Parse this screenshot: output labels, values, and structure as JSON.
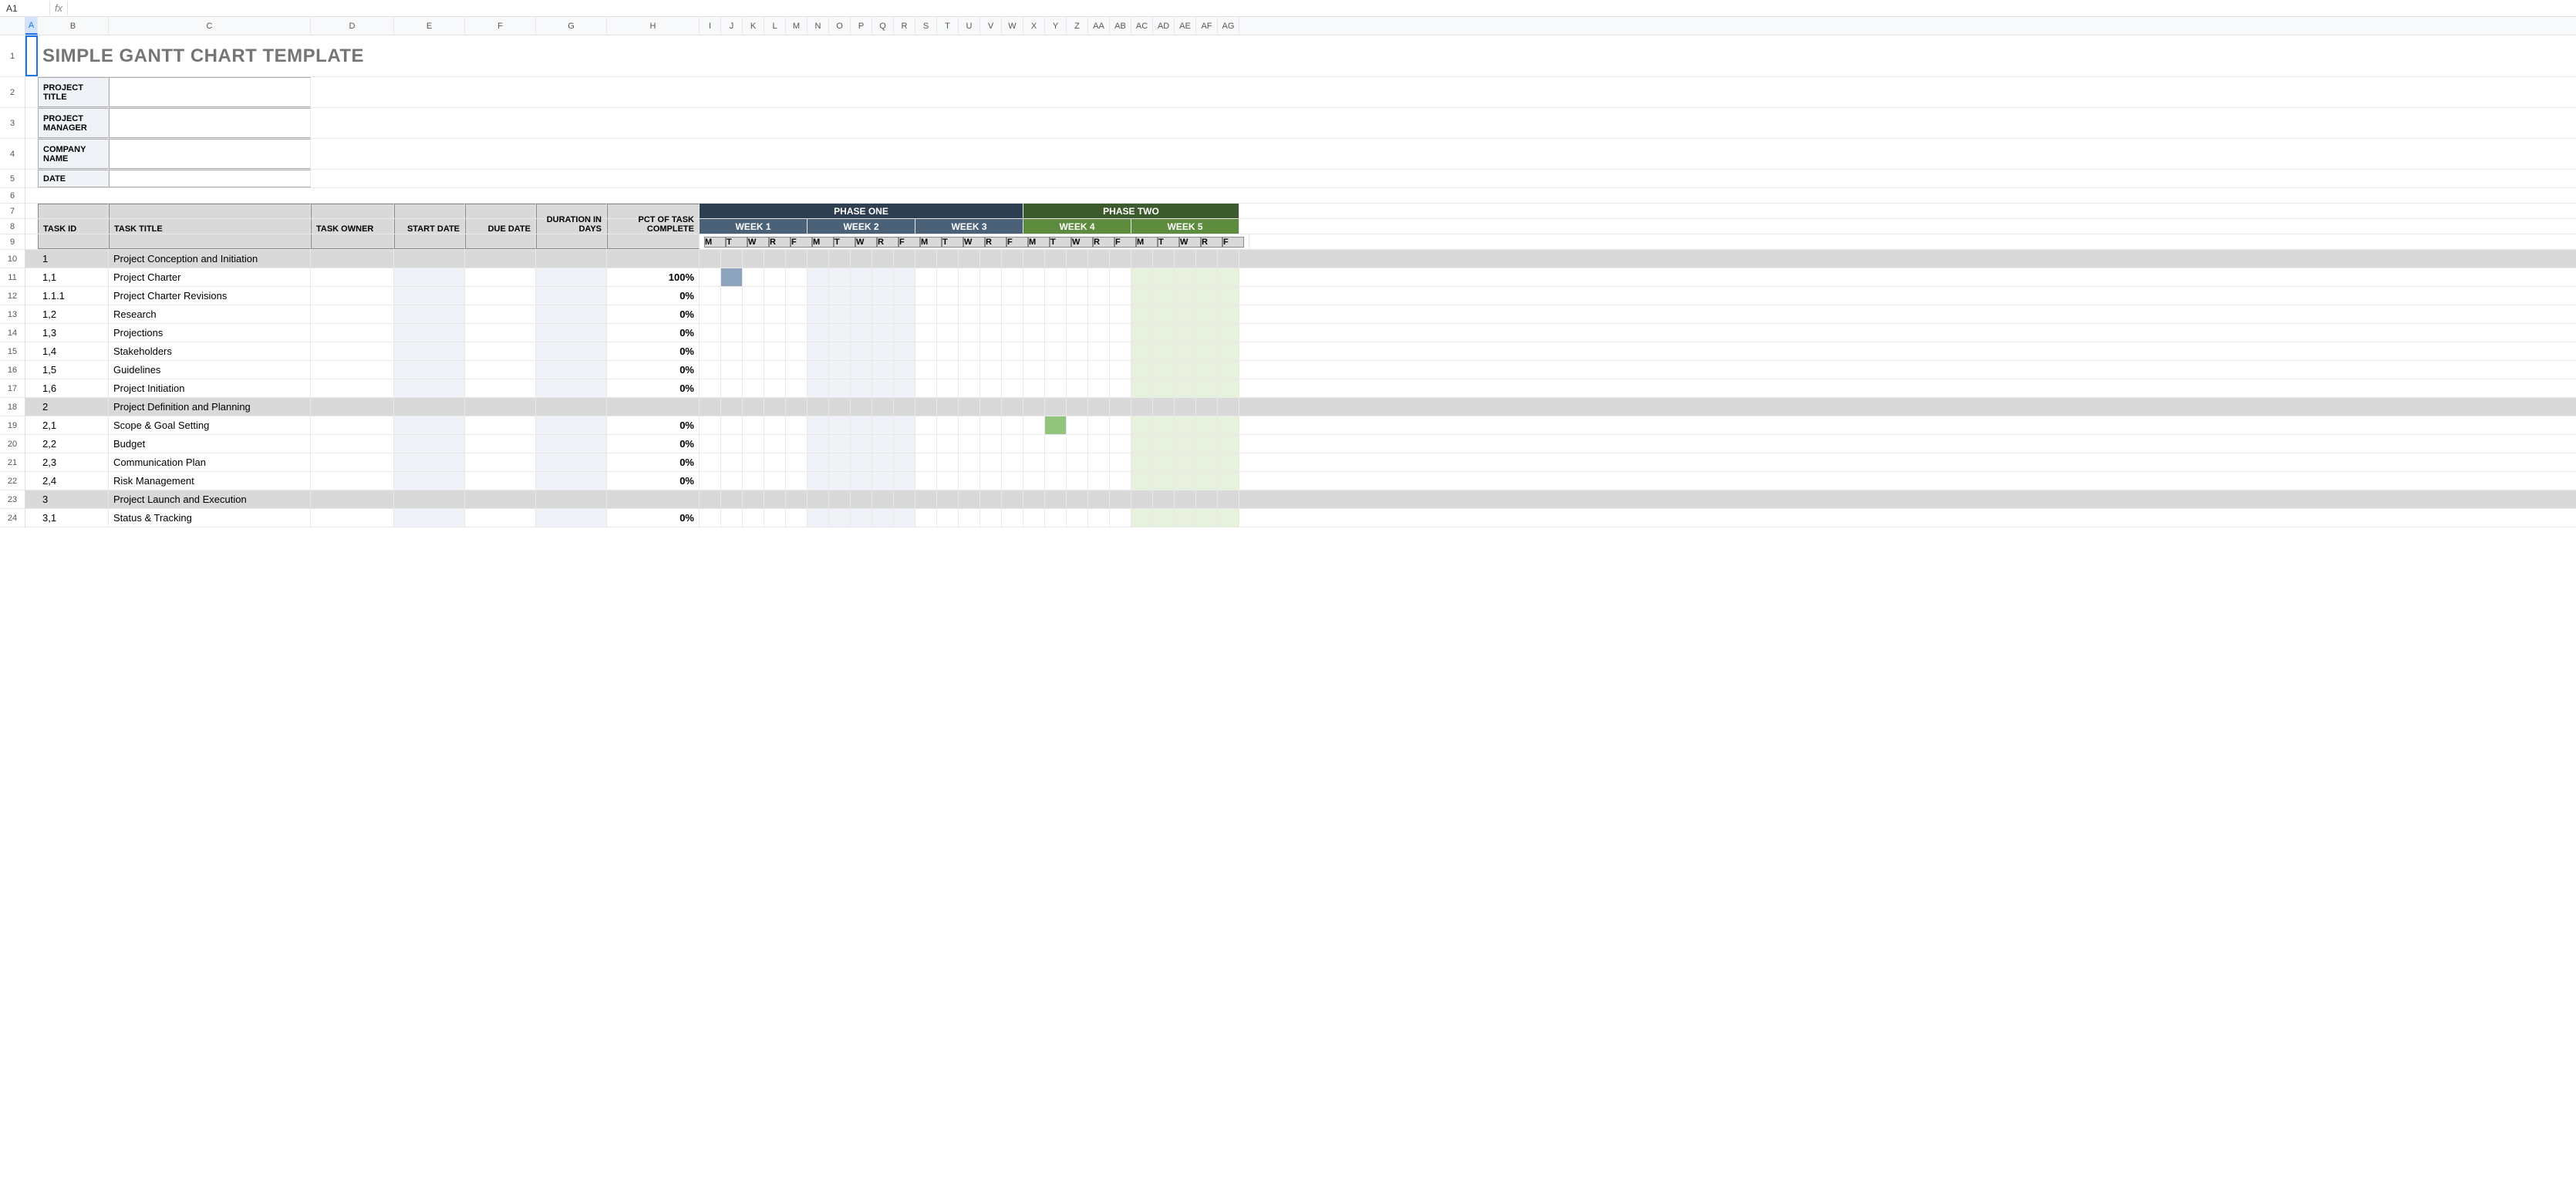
{
  "cellRef": "A1",
  "fx": "fx",
  "columns": [
    "A",
    "B",
    "C",
    "D",
    "E",
    "F",
    "G",
    "H",
    "I",
    "J",
    "K",
    "L",
    "M",
    "N",
    "O",
    "P",
    "Q",
    "R",
    "S",
    "T",
    "U",
    "V",
    "W",
    "X",
    "Y",
    "Z",
    "AA",
    "AB",
    "AC",
    "AD",
    "AE",
    "AF",
    "AG"
  ],
  "rows": [
    "1",
    "2",
    "3",
    "4",
    "5",
    "6",
    "7",
    "8",
    "9",
    "10",
    "11",
    "12",
    "13",
    "14",
    "15",
    "16",
    "17",
    "18",
    "19",
    "20",
    "21",
    "22",
    "23",
    "24"
  ],
  "title": "SIMPLE GANTT CHART TEMPLATE",
  "meta": {
    "projectTitle": "PROJECT TITLE",
    "projectManager": "PROJECT MANAGER",
    "companyName": "COMPANY NAME",
    "date": "DATE"
  },
  "headers": {
    "taskId": "TASK ID",
    "taskTitle": "TASK TITLE",
    "taskOwner": "TASK OWNER",
    "startDate": "START DATE",
    "dueDate": "DUE DATE",
    "duration": "DURATION IN DAYS",
    "pct": "PCT OF TASK COMPLETE"
  },
  "phases": {
    "p1": "PHASE ONE",
    "p2": "PHASE TWO"
  },
  "weeks": {
    "w1": "WEEK 1",
    "w2": "WEEK 2",
    "w3": "WEEK 3",
    "w4": "WEEK 4",
    "w5": "WEEK 5"
  },
  "days": [
    "M",
    "T",
    "W",
    "R",
    "F"
  ],
  "tasks": [
    {
      "id": "1",
      "title": "Project Conception and Initiation",
      "pct": "",
      "cat": true
    },
    {
      "id": "1,1",
      "title": "Project Charter",
      "pct": "100%",
      "bar": {
        "col": 1,
        "type": "blue"
      }
    },
    {
      "id": "1.1.1",
      "title": "Project Charter Revisions",
      "pct": "0%"
    },
    {
      "id": "1,2",
      "title": "Research",
      "pct": "0%"
    },
    {
      "id": "1,3",
      "title": "Projections",
      "pct": "0%"
    },
    {
      "id": "1,4",
      "title": "Stakeholders",
      "pct": "0%"
    },
    {
      "id": "1,5",
      "title": "Guidelines",
      "pct": "0%"
    },
    {
      "id": "1,6",
      "title": "Project Initiation",
      "pct": "0%"
    },
    {
      "id": "2",
      "title": "Project Definition and Planning",
      "pct": "",
      "cat": true
    },
    {
      "id": "2,1",
      "title": "Scope & Goal Setting",
      "pct": "0%",
      "bar": {
        "col": 16,
        "type": "green"
      }
    },
    {
      "id": "2,2",
      "title": "Budget",
      "pct": "0%"
    },
    {
      "id": "2,3",
      "title": "Communication Plan",
      "pct": "0%"
    },
    {
      "id": "2,4",
      "title": "Risk Management",
      "pct": "0%"
    },
    {
      "id": "3",
      "title": "Project Launch and Execution",
      "pct": "",
      "cat": true
    },
    {
      "id": "3,1",
      "title": "Status & Tracking",
      "pct": "0%"
    }
  ]
}
